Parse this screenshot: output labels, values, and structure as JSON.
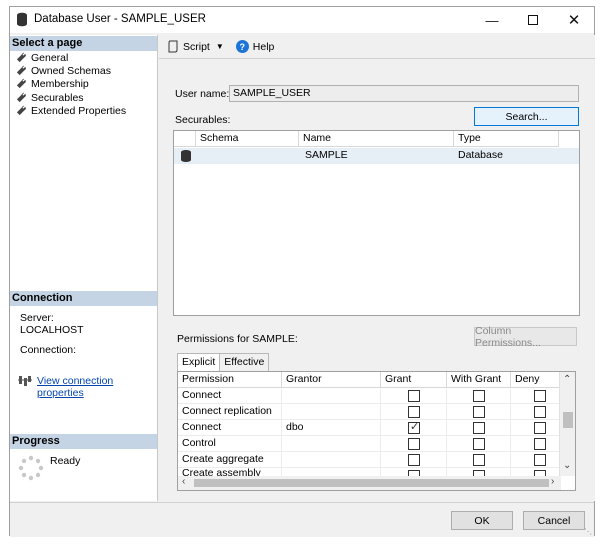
{
  "window": {
    "title": "Database User - SAMPLE_USER"
  },
  "left": {
    "select_page_header": "Select a page",
    "pages": [
      {
        "label": "General"
      },
      {
        "label": "Owned Schemas"
      },
      {
        "label": "Membership"
      },
      {
        "label": "Securables"
      },
      {
        "label": "Extended Properties"
      }
    ],
    "connection_header": "Connection",
    "server_label": "Server:",
    "server_value": "LOCALHOST",
    "connection_label": "Connection:",
    "connection_value": "",
    "view_props_link": "View connection properties",
    "progress_header": "Progress",
    "progress_status": "Ready"
  },
  "toolbar": {
    "script_label": "Script",
    "help_label": "Help"
  },
  "form": {
    "username_label": "User name:",
    "username_value": "SAMPLE_USER",
    "securables_label": "Securables:",
    "search_button": "Search..."
  },
  "securables": {
    "columns": [
      "Schema",
      "Name",
      "Type"
    ],
    "rows": [
      {
        "schema": "",
        "name": "SAMPLE",
        "type": "Database"
      }
    ]
  },
  "permissions": {
    "label": "Permissions for SAMPLE:",
    "column_permissions_button": "Column Permissions...",
    "tabs": [
      "Explicit",
      "Effective"
    ],
    "active_tab": "Explicit",
    "columns": [
      "Permission",
      "Grantor",
      "Grant",
      "With Grant",
      "Deny"
    ],
    "rows": [
      {
        "permission": "Connect",
        "grantor": "",
        "grant": false,
        "with_grant": false,
        "deny": false
      },
      {
        "permission": "Connect replication",
        "grantor": "",
        "grant": false,
        "with_grant": false,
        "deny": false
      },
      {
        "permission": "Connect",
        "grantor": "dbo",
        "grant": true,
        "with_grant": false,
        "deny": false
      },
      {
        "permission": "Control",
        "grantor": "",
        "grant": false,
        "with_grant": false,
        "deny": false
      },
      {
        "permission": "Create aggregate",
        "grantor": "",
        "grant": false,
        "with_grant": false,
        "deny": false
      },
      {
        "permission": "Create assembly",
        "grantor": "",
        "grant": false,
        "with_grant": false,
        "deny": false
      }
    ]
  },
  "footer": {
    "ok_button": "OK",
    "cancel_button": "Cancel"
  }
}
